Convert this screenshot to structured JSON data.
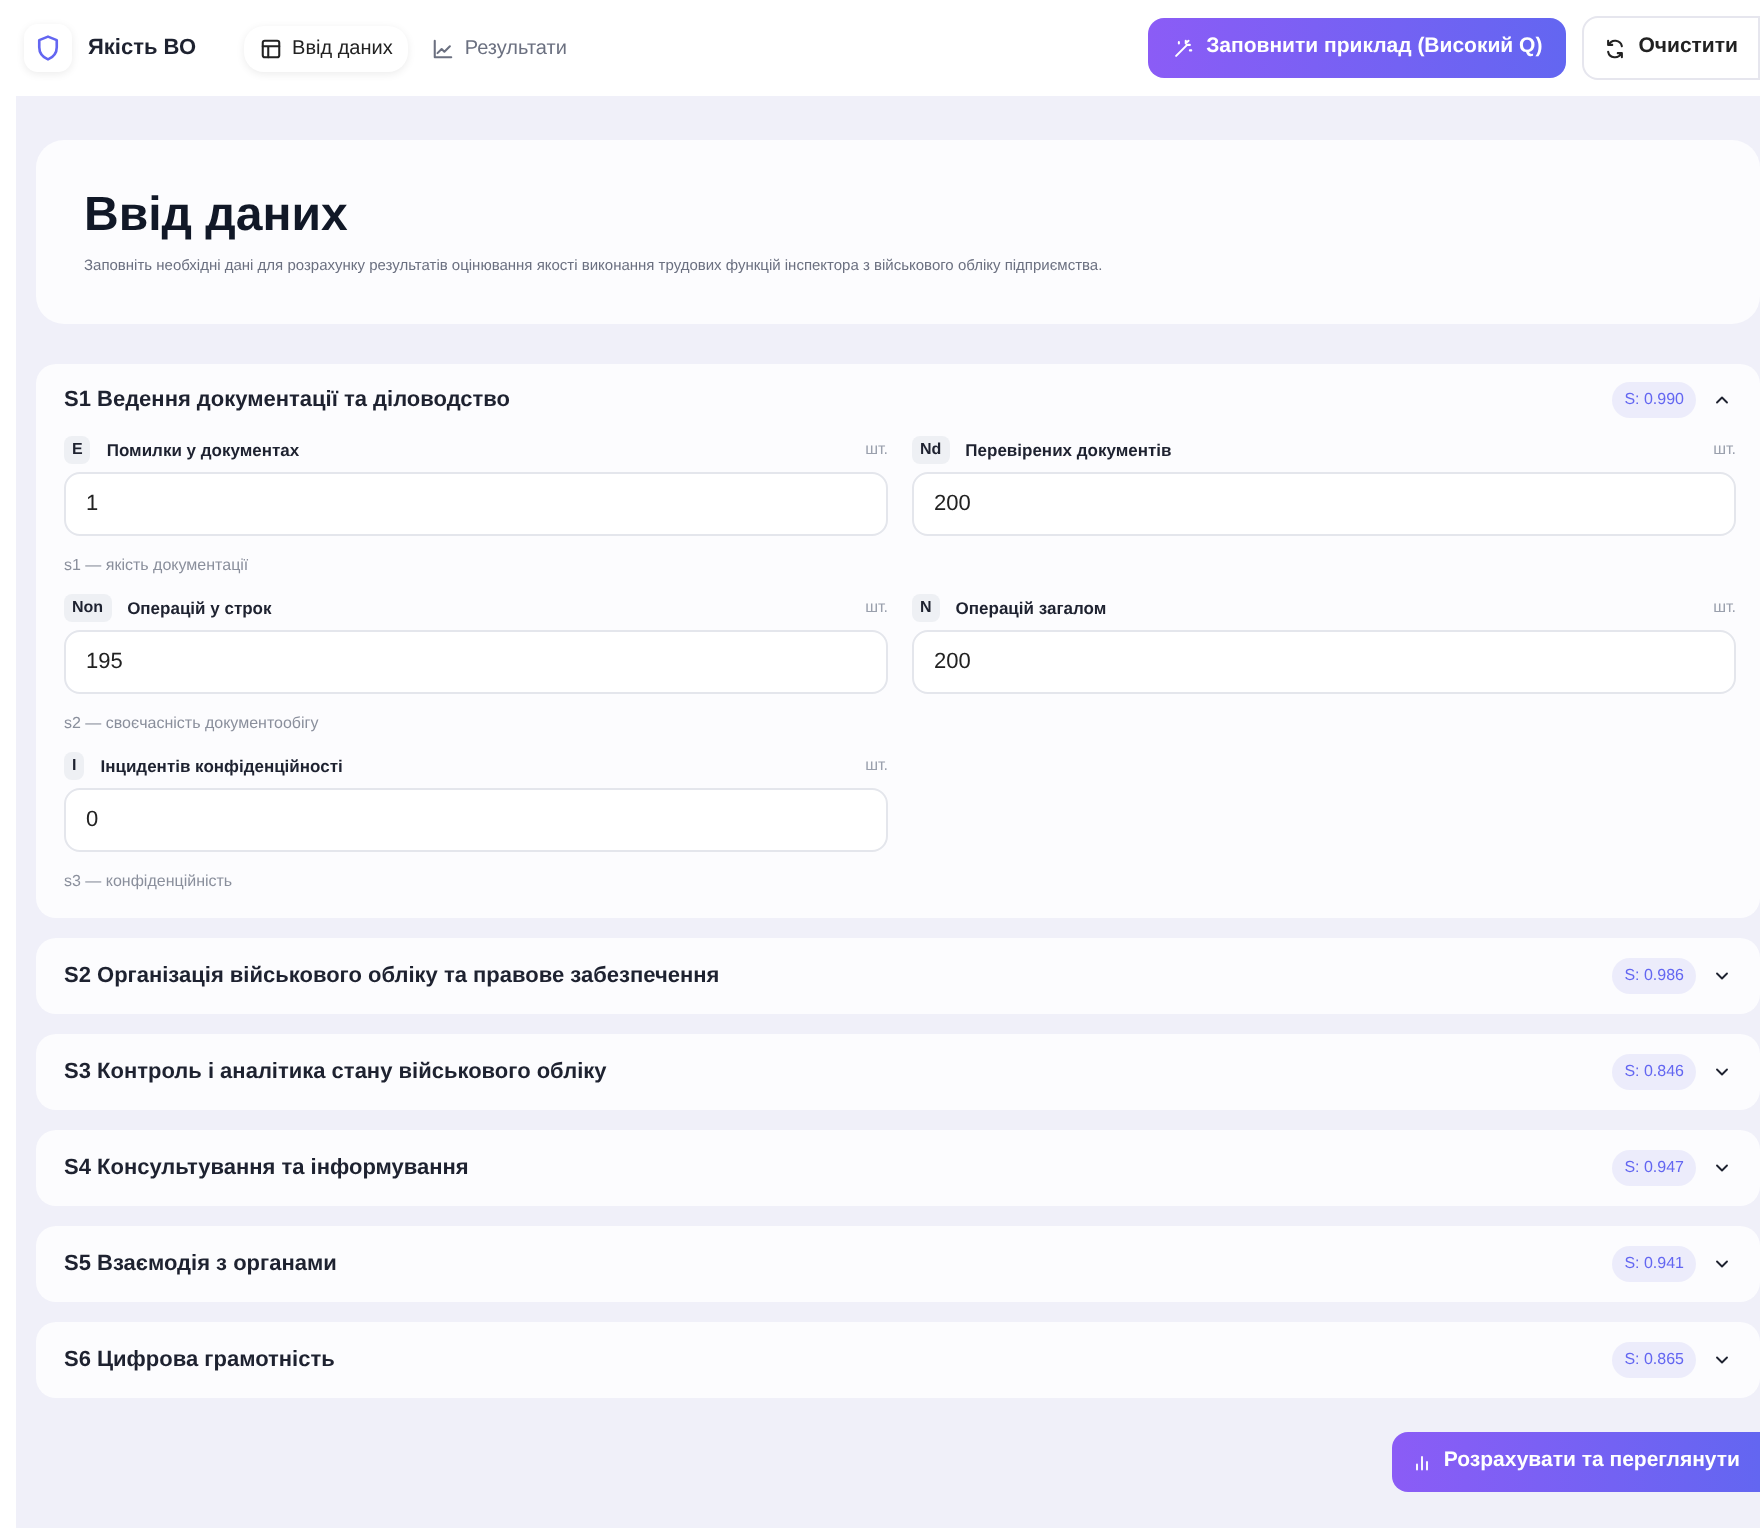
{
  "header": {
    "brand": "Якість ВО",
    "tabs": [
      {
        "label": "Ввід даних",
        "kind": "table",
        "selected": true
      },
      {
        "label": "Результати",
        "kind": "chart",
        "selected": false
      }
    ],
    "fill_button": "Заповнити приклад (Високий Q)",
    "clear_button": "Очистити"
  },
  "intro": {
    "title": "Ввід даних",
    "description": "Заповніть необхідні дані для розрахунку результатів оцінювання якості виконання трудових функцій інспектора з військового обліку підприємства."
  },
  "sections": [
    {
      "title": "S1 Ведення документації та діловодство",
      "score": "S: 0.990",
      "expanded": true,
      "rows": [
        {
          "fields": [
            {
              "code": "E",
              "label": "Помилки у документах",
              "unit": "шт.",
              "value": "1"
            },
            {
              "code": "Nd",
              "label": "Перевірених документів",
              "unit": "шт.",
              "value": "200"
            }
          ],
          "hint": "s1 — якість документації"
        },
        {
          "fields": [
            {
              "code": "Non",
              "label": "Операцій у строк",
              "unit": "шт.",
              "value": "195"
            },
            {
              "code": "N",
              "label": "Операцій загалом",
              "unit": "шт.",
              "value": "200"
            }
          ],
          "hint": "s2 — своєчасність документообігу"
        },
        {
          "fields": [
            {
              "code": "I",
              "label": "Інцидентів конфіденційності",
              "unit": "шт.",
              "value": "0"
            }
          ],
          "hint": "s3 — конфіденційність"
        }
      ]
    },
    {
      "title": "S2 Організація військового обліку та правове забезпечення",
      "score": "S: 0.986",
      "expanded": false
    },
    {
      "title": "S3 Контроль і аналітика стану військового обліку",
      "score": "S: 0.846",
      "expanded": false
    },
    {
      "title": "S4 Консультування та інформування",
      "score": "S: 0.947",
      "expanded": false
    },
    {
      "title": "S5 Взаємодія з органами",
      "score": "S: 0.941",
      "expanded": false
    },
    {
      "title": "S6 Цифрова грамотність",
      "score": "S: 0.865",
      "expanded": false
    }
  ],
  "calculate_button": "Розрахувати та переглянути"
}
